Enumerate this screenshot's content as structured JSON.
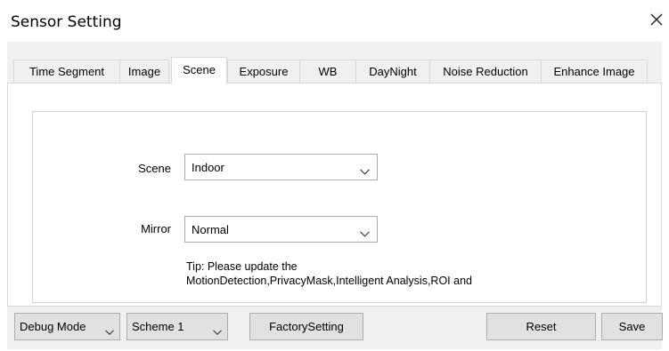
{
  "window": {
    "title": "Sensor Setting",
    "close_icon": "close-icon"
  },
  "tabs": [
    {
      "label": "Time Segment",
      "active": false
    },
    {
      "label": "Image",
      "active": false
    },
    {
      "label": "Scene",
      "active": true
    },
    {
      "label": "Exposure",
      "active": false
    },
    {
      "label": "WB",
      "active": false
    },
    {
      "label": "DayNight",
      "active": false
    },
    {
      "label": "Noise Reduction",
      "active": false
    },
    {
      "label": "Enhance Image",
      "active": false
    }
  ],
  "form": {
    "scene": {
      "label": "Scene",
      "value": "Indoor"
    },
    "mirror": {
      "label": "Mirror",
      "value": "Normal"
    },
    "tip_line1": "Tip: Please update the",
    "tip_line2": "MotionDetection,PrivacyMask,Intelligent Analysis,ROI and"
  },
  "footer": {
    "debug_mode": "Debug Mode",
    "scheme": "Scheme 1",
    "factory_setting": "FactorySetting",
    "reset": "Reset",
    "save": "Save"
  }
}
